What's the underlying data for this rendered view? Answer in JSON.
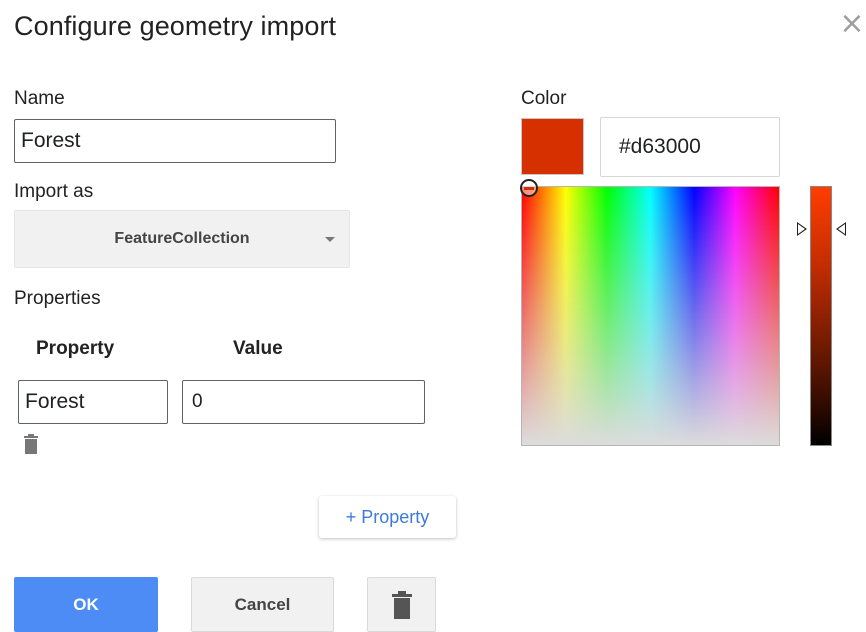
{
  "dialog": {
    "title": "Configure geometry import",
    "close_icon": "close-icon"
  },
  "name": {
    "label": "Name",
    "value": "Forest"
  },
  "import_as": {
    "label": "Import as",
    "selected": "FeatureCollection"
  },
  "properties": {
    "label": "Properties",
    "column_property": "Property",
    "column_value": "Value",
    "rows": [
      {
        "property": "Forest",
        "value": "0"
      }
    ],
    "add_label": "+ Property"
  },
  "color": {
    "label": "Color",
    "hex": "#d63000",
    "swatch": "#d63000"
  },
  "buttons": {
    "ok": "OK",
    "cancel": "Cancel",
    "delete_icon": "trash-icon"
  },
  "colors": {
    "primary": "#4d8cf5",
    "link": "#3f7ad8"
  }
}
